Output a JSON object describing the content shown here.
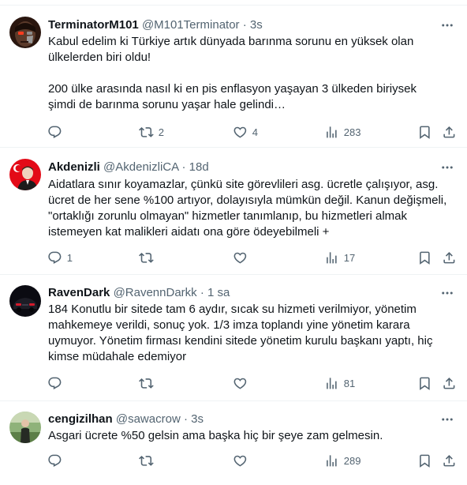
{
  "tweets": [
    {
      "name": "TerminatorM101",
      "handle": "@M101Terminator",
      "time": "3s",
      "text": "Kabul edelim ki Türkiye artık dünyada barınma sorunu en yüksek olan\nülkelerden biri oldu!\n\n200 ülke arasında nasıl ki en pis enflasyon yaşayan 3 ülkeden biriysek\nşimdi de barınma sorunu yaşar hale gelindi…",
      "replies": "",
      "retweets": "2",
      "likes": "4",
      "views": "283",
      "avatar_icon": "terminator-avatar",
      "avatar_colors": [
        "#3a1f14",
        "#b33a1c"
      ]
    },
    {
      "name": "Akdenizli",
      "handle": "@AkdenizliCA",
      "time": "18d",
      "text": "Aidatlara sınır koyamazlar, çünkü site görevlileri asg. ücretle çalışıyor, asg.\nücret de her sene %100 artıyor, dolayısıyla mümkün değil. Kanun değişmeli,\n\"ortaklığı zorunlu olmayan\" hizmetler tanımlanıp, bu hizmetleri almak\nistemeyen kat malikleri aidatı ona göre ödeyebilmeli +",
      "replies": "1",
      "retweets": "",
      "likes": "",
      "views": "17",
      "avatar_icon": "flag-portrait-avatar",
      "avatar_colors": [
        "#e30a17",
        "#f2d5c4"
      ]
    },
    {
      "name": "RavenDark",
      "handle": "@RavennDarkk",
      "time": "1 sa",
      "text": "184 Konutlu bir sitede tam 6 aydır, sıcak su hizmeti verilmiyor, yönetim\nmahkemeye verildi, sonuç yok. 1/3 imza toplandı yine yönetim karara\nuymuyor. Yönetim firması kendini sitede yönetim kurulu başkanı yaptı, hiç\nkimse müdahale edemiyor",
      "replies": "",
      "retweets": "",
      "likes": "",
      "views": "81",
      "avatar_icon": "dark-car-avatar",
      "avatar_colors": [
        "#0b0b12",
        "#c0182a"
      ]
    },
    {
      "name": "cengizilhan",
      "handle": "@sawacrow",
      "time": "3s",
      "text": "Asgari ücrete %50 gelsin ama başka hiç bir şeye zam gelmesin.",
      "replies": "",
      "retweets": "",
      "likes": "",
      "views": "289",
      "avatar_icon": "outdoor-person-avatar",
      "avatar_colors": [
        "#7fa86a",
        "#2e3b2a"
      ]
    }
  ],
  "colors": {
    "text": "#0f1419",
    "secondary": "#536471",
    "divider": "#eff3f4"
  },
  "icons": [
    "reply-icon",
    "retweet-icon",
    "like-icon",
    "views-icon",
    "bookmark-icon",
    "share-icon",
    "more-icon"
  ]
}
